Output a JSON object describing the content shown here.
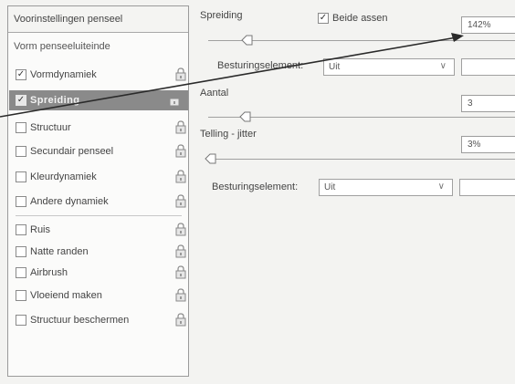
{
  "left_panel": {
    "preset_header": "Voorinstellingen penseel",
    "tip_shape": "Vorm penseeluiteinde",
    "options": [
      {
        "label": "Vormdynamiek",
        "checked": true,
        "active": false
      },
      {
        "label": "Spreiding",
        "checked": true,
        "active": true
      },
      {
        "label": "Structuur",
        "checked": false,
        "active": false
      },
      {
        "label": "Secundair penseel",
        "checked": false,
        "active": false
      },
      {
        "label": "Kleurdynamiek",
        "checked": false,
        "active": false
      },
      {
        "label": "Andere dynamiek",
        "checked": false,
        "active": false
      },
      {
        "label": "Ruis",
        "checked": false,
        "active": false
      },
      {
        "label": "Natte randen",
        "checked": false,
        "active": false
      },
      {
        "label": "Airbrush",
        "checked": false,
        "active": false
      },
      {
        "label": "Vloeiend maken",
        "checked": false,
        "active": false
      },
      {
        "label": "Structuur beschermen",
        "checked": false,
        "active": false
      }
    ]
  },
  "right_panel": {
    "scatter": {
      "label": "Spreiding",
      "both_axes_label": "Beide assen",
      "both_axes_checked": true,
      "value": "142%"
    },
    "control1": {
      "label": "Besturingselement:",
      "value": "Uit"
    },
    "count": {
      "label": "Aantal",
      "value": "3"
    },
    "count_jitter": {
      "label": "Telling - jitter",
      "value": "3%"
    },
    "control2": {
      "label": "Besturingselement:",
      "value": "Uit"
    }
  },
  "icons": {
    "lock": "lock-icon",
    "chevron": "chevron-down-icon",
    "checkmark": "check-icon"
  }
}
